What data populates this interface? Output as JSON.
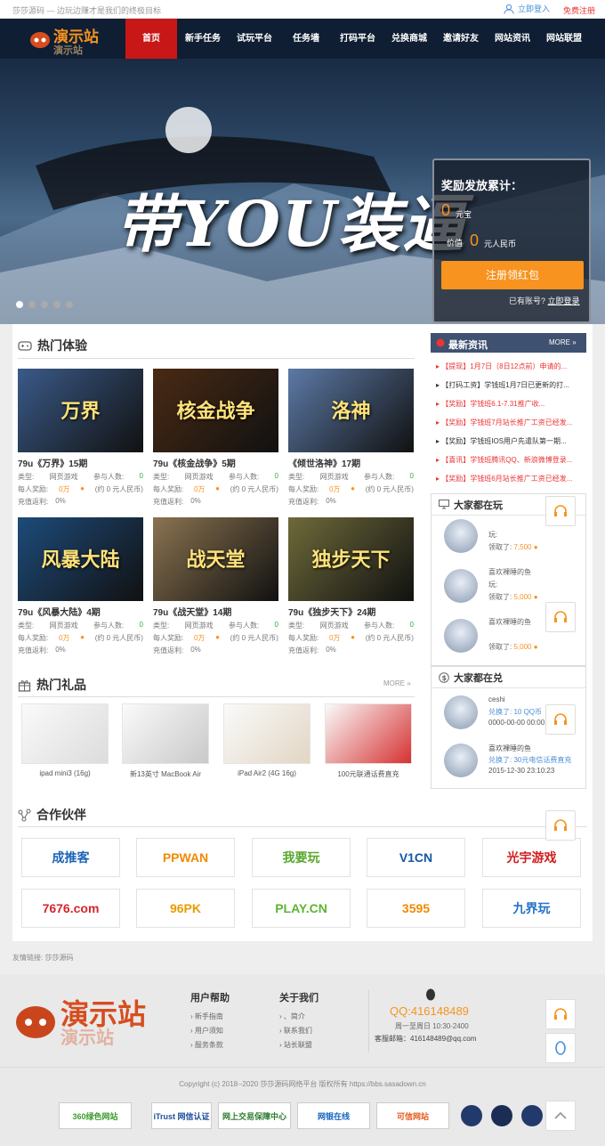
{
  "topbar": {
    "slogan": "莎莎源码 — 边玩边赚才是我们的终极目标",
    "login": "立即登入",
    "register": "免费注册"
  },
  "nav": {
    "items": [
      "首页",
      "新手任务",
      "试玩平台",
      "任务墙",
      "打码平台",
      "兑换商城",
      "邀请好友",
      "网站资讯",
      "网站联盟"
    ]
  },
  "hero": {
    "title": "带YOU装逼",
    "reward_title": "奖励发放累计：",
    "amount1": "0",
    "unit1": "元宝",
    "value_label": "价值",
    "amount2": "0",
    "unit2": "元人民币",
    "register_btn": "注册领红包",
    "has_account": "已有账号?",
    "login_now": "立即登录"
  },
  "hot": {
    "title": "热门体验",
    "more": "MORE",
    "labels": {
      "type": "类型:",
      "join": "参与人数:",
      "reward": "每人奖励:",
      "rebate": "充值返利:"
    },
    "games": [
      {
        "name": "79u《万界》15期",
        "art": "万界",
        "type": "网页游戏",
        "join": "0",
        "reward": "0万",
        "rmb": "(约 0 元人民币)",
        "rebate": "0%",
        "bg": "#3a5a88"
      },
      {
        "name": "79u《核金战争》5期",
        "art": "核金战争",
        "type": "网页游戏",
        "join": "0",
        "reward": "0万",
        "rmb": "(约 0 元人民币)",
        "rebate": "0%",
        "bg": "#4a2a14"
      },
      {
        "name": "《倾世洛神》17期",
        "art": "洛神",
        "type": "网页游戏",
        "join": "0",
        "reward": "0万",
        "rmb": "(约 0 元人民币)",
        "rebate": "0%",
        "bg": "#5c7aa6"
      },
      {
        "name": "79u《风暴大陆》4期",
        "art": "风暴大陆",
        "type": "网页游戏",
        "join": "0",
        "reward": "0万",
        "rmb": "(约 0 元人民币)",
        "rebate": "0%",
        "bg": "#1d4b7a"
      },
      {
        "name": "79u《战天堂》14期",
        "art": "战天堂",
        "type": "网页游戏",
        "join": "0",
        "reward": "0万",
        "rmb": "(约 0 元人民币)",
        "rebate": "0%",
        "bg": "#8a7350"
      },
      {
        "name": "79u《独步天下》24期",
        "art": "独步天下",
        "type": "网页游戏",
        "join": "0",
        "reward": "0万",
        "rmb": "(约 0 元人民币)",
        "rebate": "0%",
        "bg": "#6e6a3a"
      }
    ]
  },
  "gifts": {
    "title": "热门礼品",
    "more": "MORE",
    "items": [
      "ipad mini3 (16g)",
      "新13英寸 MacBook Air",
      "iPad Air2 (4G 16g)",
      "100元联通话费直充"
    ]
  },
  "partners": {
    "title": "合作伙伴",
    "items": [
      "成推客",
      "PPWAN",
      "我要玩",
      "V1CN",
      "光宇游戏",
      "7676.com",
      "96PK",
      "PLAY.CN",
      "3595",
      "九界玩"
    ]
  },
  "news": {
    "title": "最新资讯",
    "more": "MORE",
    "items": [
      "【提现】1月7日（8日12点前）申请的...",
      "【打码工资】学钱班1月7日已更新的打...",
      "【奖励】学钱班6.1-7.31推广收...",
      "【奖励】学钱班7月站长推广工资已经发...",
      "【奖励】学钱班IOS用户先遣队第一期...",
      "【喜讯】学钱班腾讯QQ、新浪微博登录...",
      "【奖励】学钱班6月站长推广工资已经发..."
    ]
  },
  "playing": {
    "title": "大家都在玩",
    "rows": [
      {
        "user": "",
        "line1": "玩:",
        "line2": "领取了:",
        "amt": "7,500"
      },
      {
        "user": "喜欢裸睡的鱼",
        "line1": "玩:",
        "line2": "领取了:",
        "amt": "5,000"
      },
      {
        "user": "喜欢裸睡的鱼",
        "line1": "",
        "line2": "领取了:",
        "amt": "5,000"
      }
    ]
  },
  "exchange": {
    "title": "大家都在兑",
    "rows": [
      {
        "user": "ceshi",
        "item": "兑换了: 10 QQ币",
        "time": "0000-00-00 00:00"
      },
      {
        "user": "喜欢裸睡的鱼",
        "item": "兑换了: 30元电信话费直充",
        "time": "2015-12-30 23:10:23"
      }
    ]
  },
  "friend": {
    "label": "友情链接:",
    "link": "莎莎源码"
  },
  "footer": {
    "help_title": "用户帮助",
    "help": [
      "新手指南",
      "用户须知",
      "服务条款"
    ],
    "about_title": "关于我们",
    "about": [
      "、简介",
      "联系我们",
      "站长联盟"
    ],
    "qq": "QQ:416148489",
    "hours": "周一至周日 10:30-2400",
    "email": "客服邮箱：416148489@qq.com",
    "copyright": "Copyright (c) 2018--2020 莎莎源码网络平台 版权所有 https://bbs.sasadown.cn",
    "badges": [
      "360绿色网站",
      "iTrust 网信认证",
      "网上交易保障中心",
      "网银在线",
      "可信网站"
    ]
  }
}
